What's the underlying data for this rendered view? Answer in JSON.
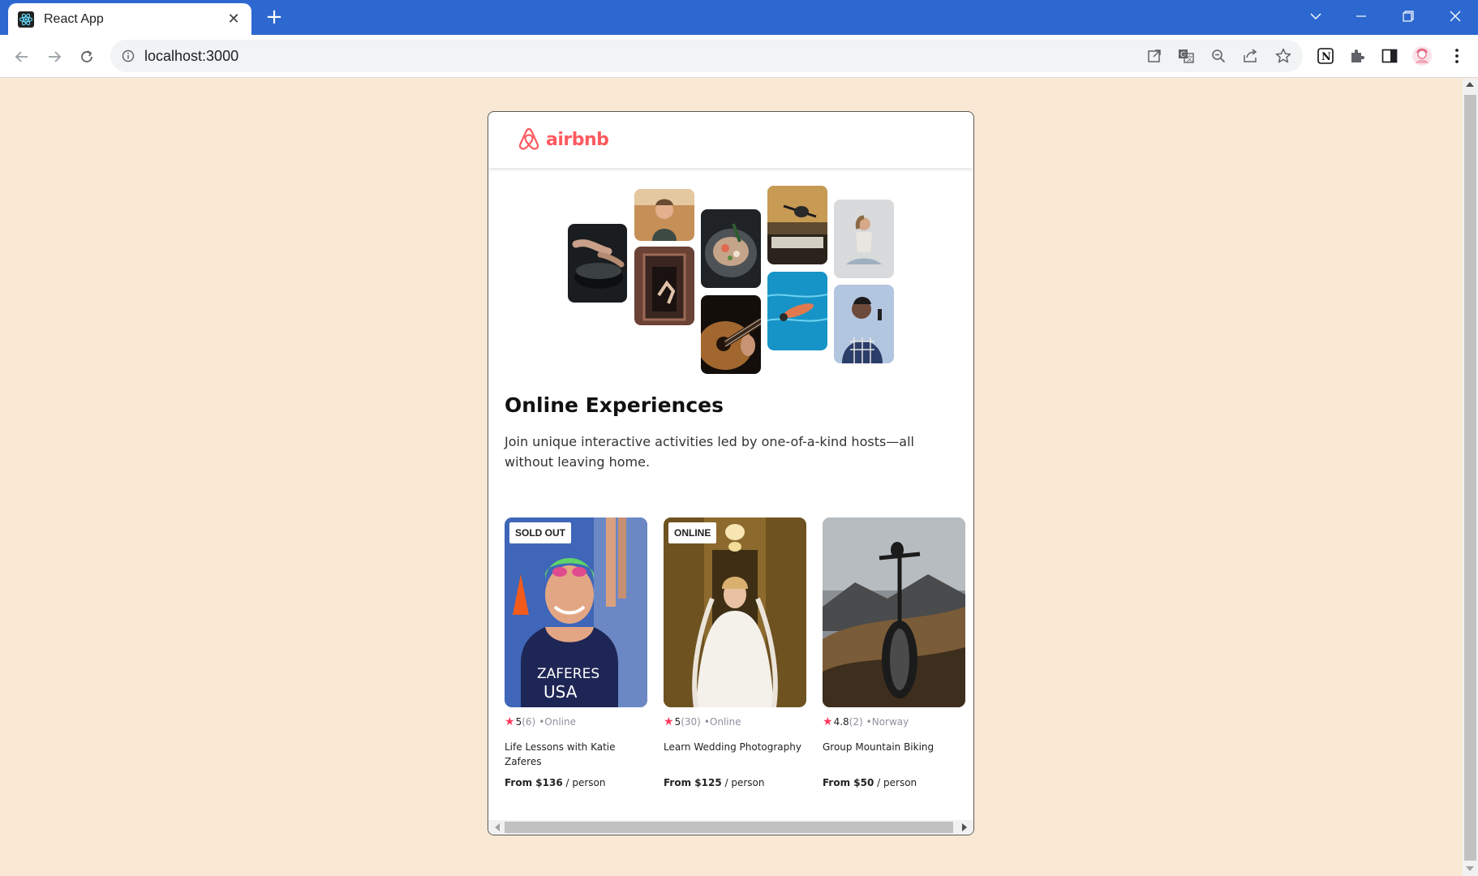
{
  "browser": {
    "tab_title": "React App",
    "tab_favicon": "react-icon",
    "url": "localhost:3000",
    "nav_icons": [
      "back-arrow-icon",
      "forward-arrow-icon",
      "reload-icon",
      "info-icon"
    ],
    "omnibox_icons": [
      "open-in-app-icon",
      "translate-icon",
      "zoom-out-icon",
      "share-icon",
      "bookmark-star-icon"
    ],
    "extension_icons": [
      "notion-icon",
      "extensions-puzzle-icon",
      "side-panel-icon",
      "profile-avatar-icon",
      "menu-kebab-icon"
    ],
    "window_controls": [
      "tab-search-icon",
      "minimize-icon",
      "restore-icon",
      "close-icon"
    ],
    "chrome_color": "#2c68cf"
  },
  "page": {
    "background_color": "#f9e8d4",
    "navbar": {
      "logo_text": "airbnb",
      "logo_icon": "airbnb-logo-icon",
      "brand_color": "#ff5a5f"
    },
    "hero": {
      "title": "Online Experiences",
      "text": "Join unique interactive activities led by one-of-a-kind hosts—all without leaving home.",
      "collage": [
        "cooking-photo",
        "woman-smiling-photo",
        "bowl-food-photo",
        "microphone-photo",
        "yoga-photo",
        "dancer-doorway-photo",
        "guitar-photo",
        "swimming-pool-photo",
        "singer-photo"
      ]
    },
    "cards": [
      {
        "badge": "SOLD OUT",
        "rating": "5",
        "reviews": "(6)",
        "location": "•Online",
        "title": "Life Lessons with Katie Zaferes",
        "price": "From $136",
        "unit": "/ person",
        "image": "swimmer-katie-zaferes-photo"
      },
      {
        "badge": "ONLINE",
        "rating": "5",
        "reviews": "(30)",
        "location": "•Online",
        "title": "Learn Wedding Photography",
        "price": "From $125",
        "unit": "/ person",
        "image": "bride-photo"
      },
      {
        "badge": "",
        "rating": "4.8",
        "reviews": "(2)",
        "location": "•Norway",
        "title": "Group Mountain Biking",
        "price": "From $50",
        "unit": "/ person",
        "image": "mountain-bike-photo"
      }
    ],
    "star_color": "#fe395c"
  }
}
